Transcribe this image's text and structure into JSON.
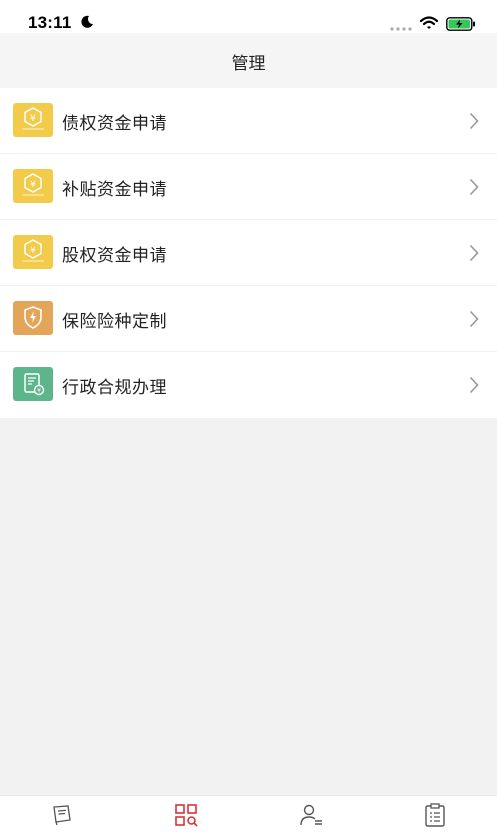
{
  "status_bar": {
    "time": "13:11"
  },
  "header": {
    "title": "管理"
  },
  "menu": {
    "items": [
      {
        "label": "债权资金申请",
        "icon": "yuan-hexagon-icon",
        "color": "#f3cb4a"
      },
      {
        "label": "补贴资金申请",
        "icon": "yuan-hexagon-icon",
        "color": "#f3cb4a"
      },
      {
        "label": "股权资金申请",
        "icon": "yuan-hexagon-icon",
        "color": "#f3cb4a"
      },
      {
        "label": "保险险种定制",
        "icon": "shield-bolt-icon",
        "color": "#e3a55a"
      },
      {
        "label": "行政合规办理",
        "icon": "document-coin-icon",
        "color": "#5db58c"
      }
    ]
  },
  "tab_bar": {
    "tabs": [
      {
        "label": "",
        "icon": "notebook-icon",
        "active": false
      },
      {
        "label": "",
        "icon": "grid-search-icon",
        "active": true
      },
      {
        "label": "",
        "icon": "user-list-icon",
        "active": false
      },
      {
        "label": "",
        "icon": "clipboard-list-icon",
        "active": false
      }
    ]
  },
  "colors": {
    "accent": "#d9343a",
    "background": "#f2f2f2"
  }
}
